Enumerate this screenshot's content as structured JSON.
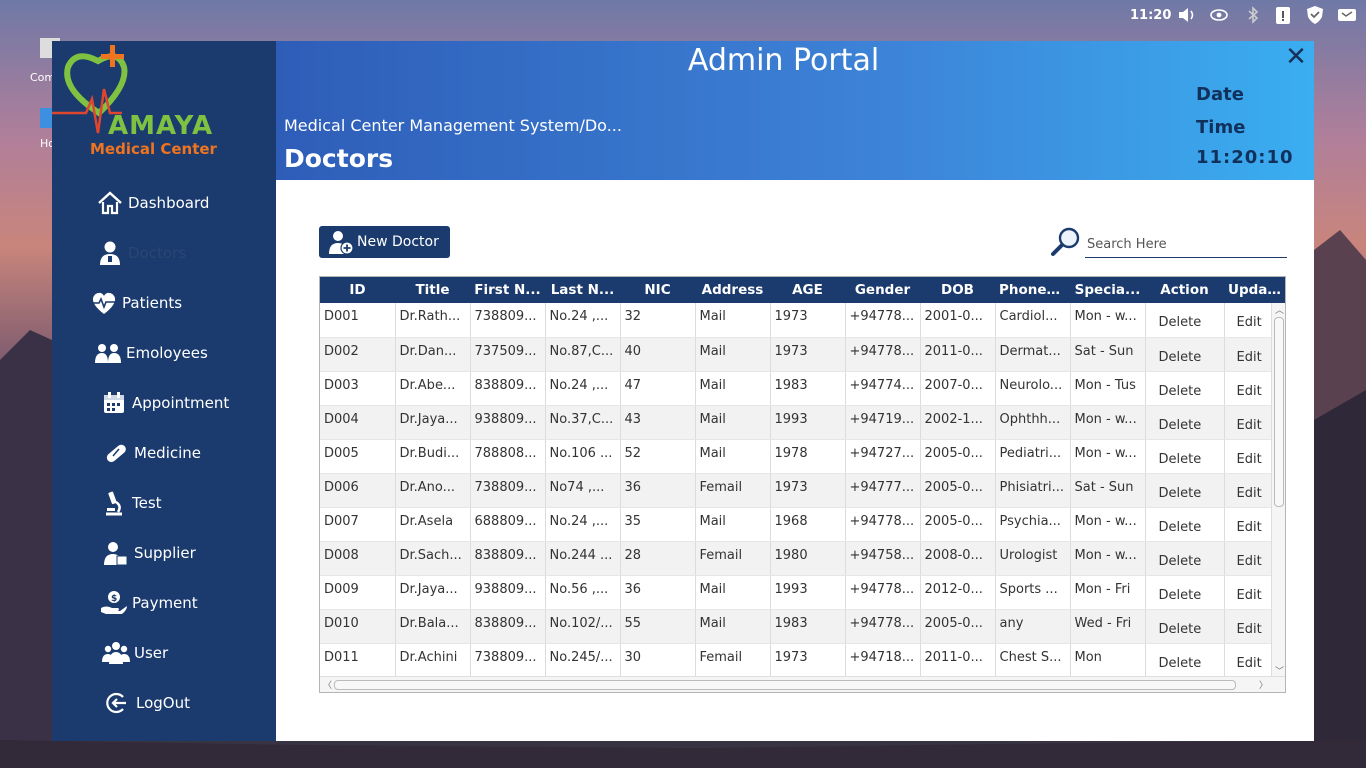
{
  "system_bar": {
    "time": "11:20"
  },
  "desktop": {
    "icons": [
      "Com",
      "Ho"
    ]
  },
  "app": {
    "header_title": "Admin Portal",
    "breadcrumb": "Medical Center Management System/Do...",
    "page_title": "Doctors",
    "date_label": "Date",
    "time_label": "Time",
    "clock": "11:20:10",
    "close_symbol": "✕"
  },
  "logo": {
    "name": "AMAYA",
    "subtitle": "Medical Center"
  },
  "sidebar": {
    "items": [
      {
        "label": "Dashboard",
        "icon": "home-icon"
      },
      {
        "label": "Doctors",
        "icon": "doctor-icon"
      },
      {
        "label": "Patients",
        "icon": "heart-pulse-icon"
      },
      {
        "label": "Emoloyees",
        "icon": "employees-icon"
      },
      {
        "label": "Appointment",
        "icon": "calendar-icon"
      },
      {
        "label": "Medicine",
        "icon": "pill-icon"
      },
      {
        "label": "Test",
        "icon": "microscope-icon"
      },
      {
        "label": "Supplier",
        "icon": "supplier-icon"
      },
      {
        "label": "Payment",
        "icon": "payment-icon"
      },
      {
        "label": "User",
        "icon": "users-icon"
      },
      {
        "label": "LogOut",
        "icon": "logout-icon"
      }
    ],
    "active_index": 1
  },
  "toolbar": {
    "new_doctor_label": "New Doctor",
    "search_placeholder": "Search Here"
  },
  "table": {
    "columns": [
      "ID",
      "Title",
      "First N...",
      "Last N...",
      "NIC",
      "Address",
      "AGE",
      "Gender",
      "DOB",
      "PhoneNo",
      "Specia...",
      "Action",
      "Update"
    ],
    "rows": [
      [
        "D001",
        "Dr.Rath...",
        "738809...",
        "No.24 ,...",
        "32",
        "Mail",
        "1973",
        "+94778...",
        "2001-0...",
        "Cardiol...",
        "Mon - w...",
        "Delete",
        "Edit"
      ],
      [
        "D002",
        "Dr.Dan...",
        "737509...",
        "No.87,C...",
        "40",
        "Mail",
        "1973",
        "+94778...",
        "2011-0...",
        "Dermat...",
        "Sat - Sun",
        "Delete",
        "Edit"
      ],
      [
        "D003",
        "Dr.Abe...",
        "838809...",
        "No.24 ,...",
        "47",
        "Mail",
        "1983",
        "+94774...",
        "2007-0...",
        "Neurolo...",
        "Mon - Tus",
        "Delete",
        "Edit"
      ],
      [
        "D004",
        "Dr.Jaya...",
        "938809...",
        "No.37,C...",
        "43",
        "Mail",
        "1993",
        "+94719...",
        "2002-1...",
        "Ophthh...",
        "Mon - w...",
        "Delete",
        "Edit"
      ],
      [
        "D005",
        "Dr.Budi...",
        "788808...",
        "No.106 ...",
        "52",
        "Mail",
        "1978",
        "+94727...",
        "2005-0...",
        "Pediatri...",
        "Mon - w...",
        "Delete",
        "Edit"
      ],
      [
        "D006",
        "Dr.Ano...",
        "738809...",
        "No74 ,...",
        "36",
        "Femail",
        "1973",
        "+94777...",
        "2005-0...",
        "Phisiatri...",
        "Sat - Sun",
        "Delete",
        "Edit"
      ],
      [
        "D007",
        "Dr.Asela",
        "688809...",
        "No.24 ,...",
        "35",
        "Mail",
        "1968",
        "+94778...",
        "2005-0...",
        "Psychia...",
        "Mon - w...",
        "Delete",
        "Edit"
      ],
      [
        "D008",
        "Dr.Sach...",
        "838809...",
        "No.244 ...",
        "28",
        "Femail",
        "1980",
        "+94758...",
        "2008-0...",
        "Urologist",
        "Mon - w...",
        "Delete",
        "Edit"
      ],
      [
        "D009",
        "Dr.Jaya...",
        "938809...",
        "No.56 ,...",
        "36",
        "Mail",
        "1993",
        "+94778...",
        "2012-0...",
        "Sports ...",
        "Mon - Fri",
        "Delete",
        "Edit"
      ],
      [
        "D010",
        "Dr.Bala...",
        "838809...",
        "No.102/...",
        "55",
        "Mail",
        "1983",
        "+94778...",
        "2005-0...",
        "any",
        "Wed - Fri",
        "Delete",
        "Edit"
      ],
      [
        "D011",
        "Dr.Achini",
        "738809...",
        "No.245/...",
        "30",
        "Femail",
        "1973",
        "+94718...",
        "2011-0...",
        "Chest S...",
        "Mon",
        "Delete",
        "Edit"
      ]
    ]
  },
  "colors": {
    "sidebar": "#1b3b6e",
    "header_start": "#2e5db8",
    "header_end": "#3aaef0",
    "logo_green": "#7fc241",
    "logo_orange": "#f0741f"
  }
}
